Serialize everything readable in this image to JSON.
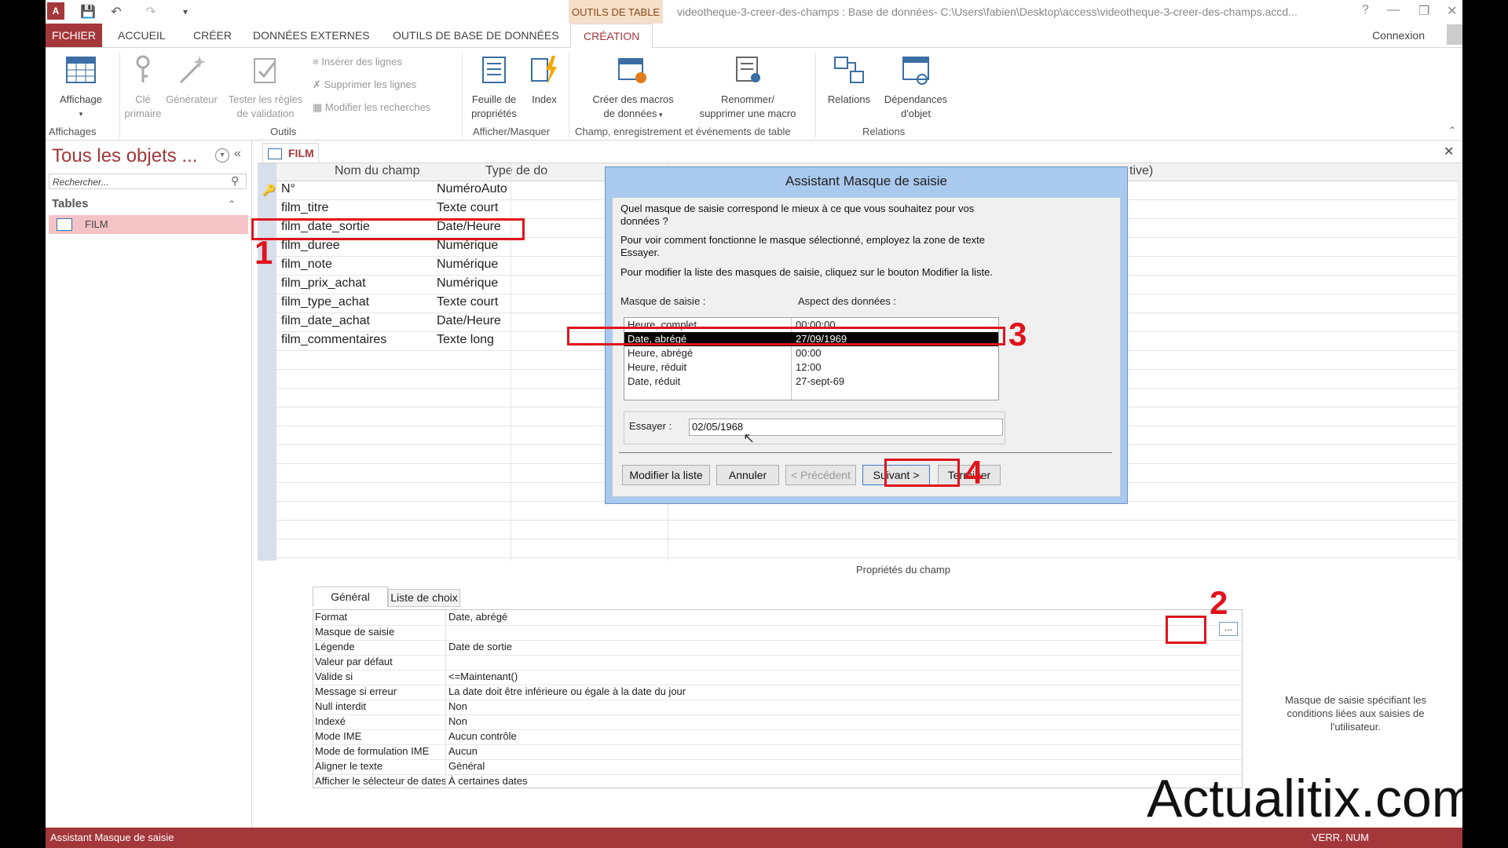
{
  "window": {
    "context_tab": "OUTILS DE TABLE",
    "title": "videotheque-3-creer-des-champs : Base de données- C:\\Users\\fabien\\Desktop\\access\\videotheque-3-creer-des-champs.accd...",
    "help": "?",
    "connexion": "Connexion"
  },
  "ribbon_tabs": [
    "FICHIER",
    "ACCUEIL",
    "CRÉER",
    "DONNÉES EXTERNES",
    "OUTILS DE BASE DE DONNÉES",
    "CRÉATION"
  ],
  "ribbon": {
    "affichage": "Affichage",
    "cle_primaire_1": "Clé",
    "cle_primaire_2": "primaire",
    "generateur": "Générateur",
    "tester_1": "Tester les règles",
    "tester_2": "de validation",
    "inserer_lignes": "Insérer des lignes",
    "supprimer_lignes": "Supprimer les lignes",
    "modifier_recherches": "Modifier les recherches",
    "feuille_1": "Feuille de",
    "feuille_2": "propriétés",
    "index": "Index",
    "macros_1": "Créer des macros",
    "macros_2": "de données",
    "renommer_1": "Renommer/",
    "renommer_2": "supprimer une macro",
    "relations": "Relations",
    "dependances_1": "Dépendances",
    "dependances_2": "d'objet",
    "groups": {
      "affichages": "Affichages",
      "outils": "Outils",
      "afficher_masquer": "Afficher/Masquer",
      "champ_evenements": "Champ, enregistrement et événements de table",
      "relations": "Relations"
    }
  },
  "nav": {
    "title": "Tous les objets ...",
    "search_placeholder": "Rechercher...",
    "section": "Tables",
    "item": "FILM"
  },
  "doc_tab": "FILM",
  "grid": {
    "col_name": "Nom du champ",
    "col_type": "Type de do",
    "col_desc_tail": "tive)",
    "rows": [
      {
        "name": "N°",
        "type": "NuméroAuto"
      },
      {
        "name": "film_titre",
        "type": "Texte court"
      },
      {
        "name": "film_date_sortie",
        "type": "Date/Heure"
      },
      {
        "name": "film_duree",
        "type": "Numérique"
      },
      {
        "name": "film_note",
        "type": "Numérique"
      },
      {
        "name": "film_prix_achat",
        "type": "Numérique"
      },
      {
        "name": "film_type_achat",
        "type": "Texte court"
      },
      {
        "name": "film_date_achat",
        "type": "Date/Heure"
      },
      {
        "name": "film_commentaires",
        "type": "Texte long"
      }
    ]
  },
  "properties": {
    "title": "Propriétés du champ",
    "tab_general": "Général",
    "tab_liste": "Liste de choix",
    "rows": [
      {
        "label": "Format",
        "value": "Date, abrégé"
      },
      {
        "label": "Masque de saisie",
        "value": ""
      },
      {
        "label": "Légende",
        "value": "Date de sortie"
      },
      {
        "label": "Valeur par défaut",
        "value": ""
      },
      {
        "label": "Valide si",
        "value": "<=Maintenant()"
      },
      {
        "label": "Message si erreur",
        "value": "La date doit être inférieure ou égale à la date du jour"
      },
      {
        "label": "Null interdit",
        "value": "Non"
      },
      {
        "label": "Indexé",
        "value": "Non"
      },
      {
        "label": "Mode IME",
        "value": "Aucun contrôle"
      },
      {
        "label": "Mode de formulation IME",
        "value": "Aucun"
      },
      {
        "label": "Aligner le texte",
        "value": "Général"
      },
      {
        "label": "Afficher le sélecteur de dates",
        "value": "À certaines dates"
      }
    ],
    "ellipsis": "...",
    "help": "Masque de saisie spécifiant les conditions liées aux saisies de l'utilisateur."
  },
  "dialog": {
    "title": "Assistant Masque de saisie",
    "q1": "Quel masque de saisie correspond le mieux à ce que vous souhaitez pour vos données ?",
    "q2": "Pour voir comment fonctionne le masque sélectionné, employez la zone de texte Essayer.",
    "q3": "Pour modifier la liste des masques de saisie, cliquez sur le bouton Modifier la liste.",
    "col_mask": "Masque de saisie :",
    "col_aspect": "Aspect des données :",
    "masks": [
      {
        "name": "Heure, complet",
        "aspect": "00:00:00"
      },
      {
        "name": "Date, abrégé",
        "aspect": "27/09/1969"
      },
      {
        "name": "Heure, abrégé",
        "aspect": "00:00"
      },
      {
        "name": "Heure, réduit",
        "aspect": "12:00"
      },
      {
        "name": "Date, réduit",
        "aspect": "27-sept-69"
      }
    ],
    "selected_index": 1,
    "essayer_label": "Essayer :",
    "essayer_value": "02/05/1968",
    "btn_modifier": "Modifier la liste",
    "btn_annuler": "Annuler",
    "btn_precedent": "< Précédent",
    "btn_suivant": "Suivant >",
    "btn_terminer": "Terminer"
  },
  "annotations": [
    "1",
    "2",
    "3",
    "4"
  ],
  "watermark": "Actualitix.com",
  "status": {
    "left": "Assistant Masque de saisie",
    "right": "VERR. NUM"
  },
  "colors": {
    "accent": "#a4373a",
    "annotation": "#e0141c",
    "dialog_frame": "#a9c9ee"
  }
}
